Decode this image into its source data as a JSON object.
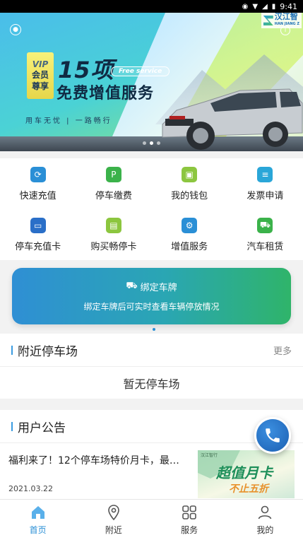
{
  "status_bar": {
    "time": "9:41"
  },
  "banner": {
    "logo_text": "汉江智",
    "logo_sub": "HAN JIANG Z",
    "vip_badge": "VIP",
    "vip_line1": "会员",
    "vip_line2": "尊享",
    "headline": "15项",
    "free_tag": "Free service",
    "subheadline": "免费增值服务",
    "slogan": "用车无忧 | 一路畅行"
  },
  "grid_menu": {
    "items": [
      {
        "label": "快速充值",
        "icon": "charge-icon",
        "color": "#2a8fd6"
      },
      {
        "label": "停车缴费",
        "icon": "parking-pay-icon",
        "color": "#3bb24a"
      },
      {
        "label": "我的钱包",
        "icon": "wallet-icon",
        "color": "#8cc63f"
      },
      {
        "label": "发票申请",
        "icon": "invoice-icon",
        "color": "#2aa6d8"
      },
      {
        "label": "停车充值卡",
        "icon": "card-icon",
        "color": "#2a6fc8"
      },
      {
        "label": "购买畅停卡",
        "icon": "buy-card-icon",
        "color": "#8cc63f"
      },
      {
        "label": "增值服务",
        "icon": "service-icon",
        "color": "#2a8fd6"
      },
      {
        "label": "汽车租赁",
        "icon": "car-rental-icon",
        "color": "#3bb24a"
      }
    ]
  },
  "bind_card": {
    "title": "绑定车牌",
    "description": "绑定车牌后可实时查看车辆停放情况"
  },
  "nearby": {
    "title": "附近停车场",
    "more": "更多",
    "empty_text": "暂无停车场"
  },
  "notice": {
    "title": "用户公告",
    "item_title": "福利来了！12个停车场特价月卡，最…",
    "item_date": "2021.03.22",
    "thumb_big": "超值月卡",
    "thumb_small": "不止五折",
    "thumb_tiny": "汉江智行"
  },
  "tabbar": {
    "items": [
      {
        "label": "首页",
        "icon": "home-icon",
        "active": true
      },
      {
        "label": "附近",
        "icon": "location-icon",
        "active": false
      },
      {
        "label": "服务",
        "icon": "grid-icon",
        "active": false
      },
      {
        "label": "我的",
        "icon": "profile-icon",
        "active": false
      }
    ]
  },
  "colors": {
    "accent": "#2a8fd6",
    "green": "#3bb24a"
  }
}
